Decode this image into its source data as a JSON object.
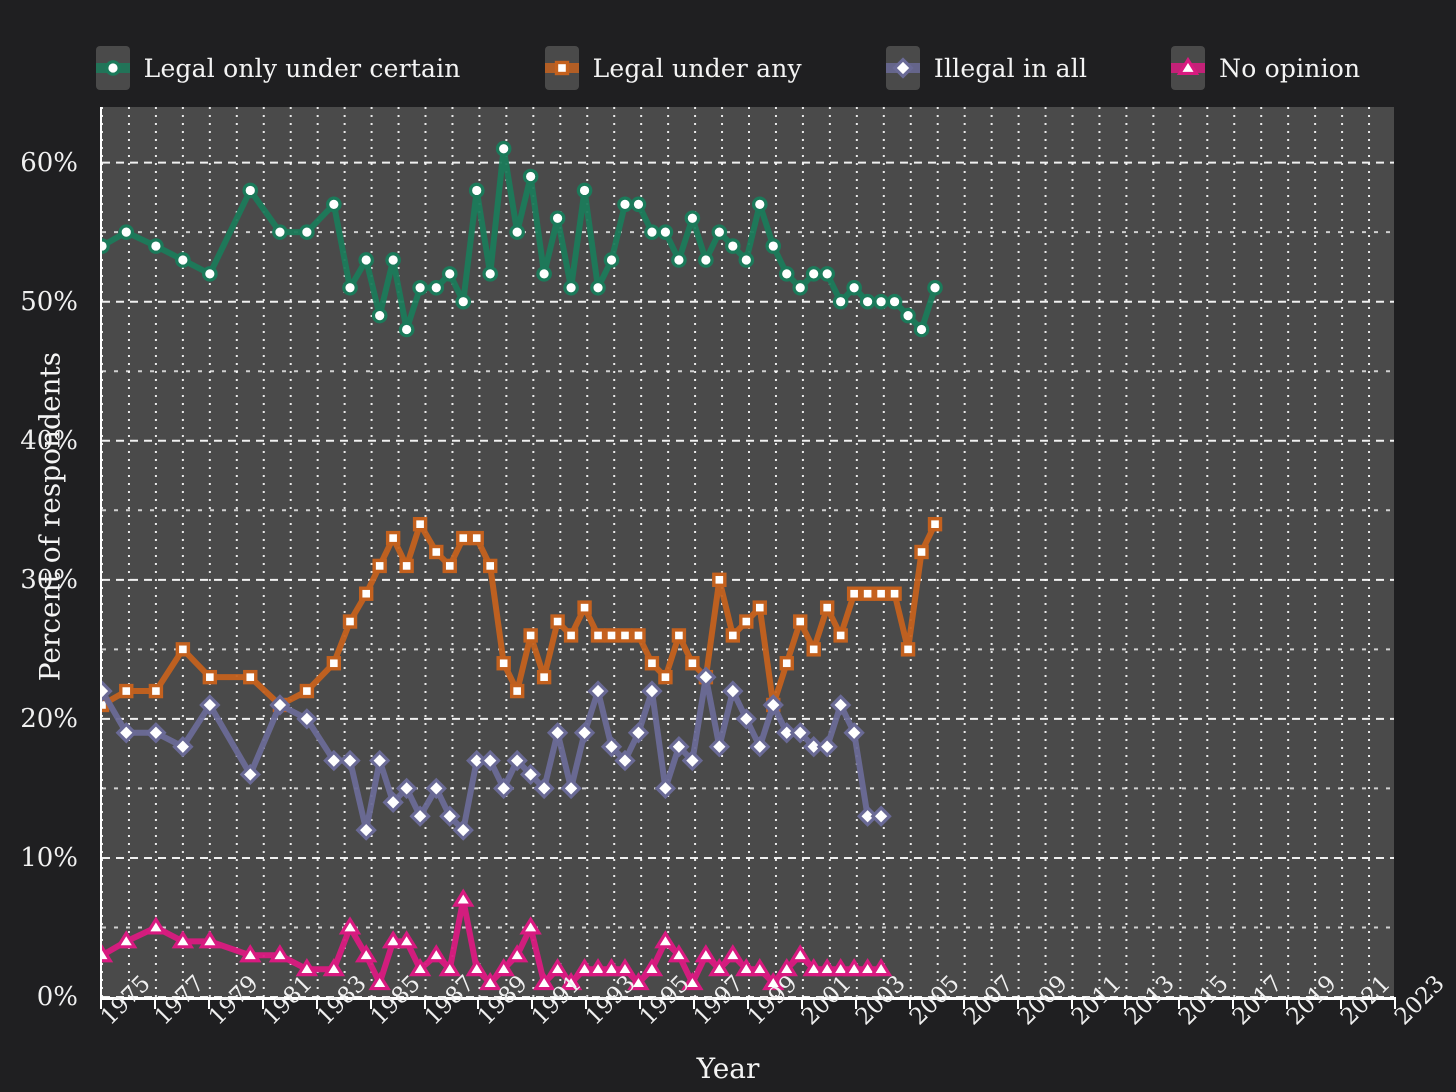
{
  "chart_data": {
    "type": "line",
    "title": "",
    "xlabel": "Year",
    "ylabel": "Percent of respondents",
    "xlim": [
      1975,
      2023
    ],
    "ylim": [
      0,
      64
    ],
    "yticks": [
      0,
      10,
      20,
      30,
      40,
      50,
      60
    ],
    "ytick_labels": [
      "0%",
      "10%",
      "20%",
      "30%",
      "40%",
      "50%",
      "60%"
    ],
    "y_minor_step": 5,
    "xticks": [
      1975,
      1977,
      1979,
      1981,
      1983,
      1985,
      1987,
      1989,
      1991,
      1993,
      1995,
      1997,
      1999,
      2001,
      2003,
      2005,
      2007,
      2009,
      2011,
      2013,
      2015,
      2017,
      2019,
      2021,
      2023
    ],
    "xtick_labels": [
      "1975",
      "1977",
      "1979",
      "1981",
      "1983",
      "1985",
      "1987",
      "1989",
      "1991",
      "1993",
      "1995",
      "1997",
      "1999",
      "2001",
      "2003",
      "2005",
      "2007",
      "2009",
      "2011",
      "2013",
      "2015",
      "2017",
      "2019",
      "2021",
      "2023"
    ],
    "grid": true,
    "grid_style": "dotted-white",
    "legend_position": "top-center",
    "background": "#1f1f21",
    "plot_background": "#4a4a4a",
    "series": [
      {
        "name": "Legal only under certain",
        "color": "#1b7a5a",
        "marker": "circle",
        "points": [
          [
            1975.0,
            54
          ],
          [
            1975.9,
            55
          ],
          [
            1977.0,
            54
          ],
          [
            1978.0,
            53
          ],
          [
            1979.0,
            52
          ],
          [
            1980.5,
            58
          ],
          [
            1981.6,
            55
          ],
          [
            1982.6,
            55
          ],
          [
            1983.6,
            57
          ],
          [
            1984.2,
            51
          ],
          [
            1984.8,
            53
          ],
          [
            1985.3,
            49
          ],
          [
            1985.8,
            53
          ],
          [
            1986.3,
            48
          ],
          [
            1986.8,
            51
          ],
          [
            1987.4,
            51
          ],
          [
            1987.9,
            52
          ],
          [
            1988.4,
            50
          ],
          [
            1988.9,
            58
          ],
          [
            1989.4,
            52
          ],
          [
            1989.9,
            61
          ],
          [
            1990.4,
            55
          ],
          [
            1990.9,
            59
          ],
          [
            1991.4,
            52
          ],
          [
            1991.9,
            56
          ],
          [
            1992.4,
            51
          ],
          [
            1992.9,
            58
          ],
          [
            1993.4,
            51
          ],
          [
            1993.9,
            53
          ],
          [
            1994.4,
            57
          ],
          [
            1994.9,
            57
          ],
          [
            1995.4,
            55
          ],
          [
            1995.9,
            55
          ],
          [
            1996.4,
            53
          ],
          [
            1996.9,
            56
          ],
          [
            1997.4,
            53
          ],
          [
            1997.9,
            55
          ],
          [
            1998.4,
            54
          ],
          [
            1998.9,
            53
          ],
          [
            1999.4,
            57
          ],
          [
            1999.9,
            54
          ],
          [
            2000.4,
            52
          ],
          [
            2000.9,
            51
          ],
          [
            2001.4,
            52
          ],
          [
            2001.9,
            52
          ],
          [
            2002.4,
            50
          ],
          [
            2002.9,
            51
          ],
          [
            2003.4,
            50
          ],
          [
            2003.9,
            50
          ],
          [
            2004.4,
            50
          ],
          [
            2004.9,
            49
          ],
          [
            2005.4,
            48
          ],
          [
            2005.9,
            51
          ]
        ]
      },
      {
        "name": "Legal under any",
        "color": "#c4611e",
        "marker": "square",
        "points": [
          [
            1975.0,
            21
          ],
          [
            1975.9,
            22
          ],
          [
            1977.0,
            22
          ],
          [
            1978.0,
            25
          ],
          [
            1979.0,
            23
          ],
          [
            1980.5,
            23
          ],
          [
            1981.6,
            21
          ],
          [
            1982.6,
            22
          ],
          [
            1983.6,
            24
          ],
          [
            1984.2,
            27
          ],
          [
            1984.8,
            29
          ],
          [
            1985.3,
            31
          ],
          [
            1985.8,
            33
          ],
          [
            1986.3,
            31
          ],
          [
            1986.8,
            34
          ],
          [
            1987.4,
            32
          ],
          [
            1987.9,
            31
          ],
          [
            1988.4,
            33
          ],
          [
            1988.9,
            33
          ],
          [
            1989.4,
            31
          ],
          [
            1989.9,
            24
          ],
          [
            1990.4,
            22
          ],
          [
            1990.9,
            26
          ],
          [
            1991.4,
            23
          ],
          [
            1991.9,
            27
          ],
          [
            1992.4,
            26
          ],
          [
            1992.9,
            28
          ],
          [
            1993.4,
            26
          ],
          [
            1993.9,
            26
          ],
          [
            1994.4,
            26
          ],
          [
            1994.9,
            26
          ],
          [
            1995.4,
            24
          ],
          [
            1995.9,
            23
          ],
          [
            1996.4,
            26
          ],
          [
            1996.9,
            24
          ],
          [
            1997.4,
            23
          ],
          [
            1997.9,
            30
          ],
          [
            1998.4,
            26
          ],
          [
            1998.9,
            27
          ],
          [
            1999.4,
            28
          ],
          [
            1999.9,
            21
          ],
          [
            2000.4,
            24
          ],
          [
            2000.9,
            27
          ],
          [
            2001.4,
            25
          ],
          [
            2001.9,
            28
          ],
          [
            2002.4,
            26
          ],
          [
            2002.9,
            29
          ],
          [
            2003.4,
            29
          ],
          [
            2003.9,
            29
          ],
          [
            2004.4,
            29
          ],
          [
            2004.9,
            25
          ],
          [
            2005.4,
            32
          ],
          [
            2005.9,
            34
          ]
        ]
      },
      {
        "name": "Illegal in all",
        "color": "#6a6a96",
        "marker": "diamond",
        "points": [
          [
            1975.0,
            22
          ],
          [
            1975.9,
            19
          ],
          [
            1977.0,
            19
          ],
          [
            1978.0,
            18
          ],
          [
            1979.0,
            21
          ],
          [
            1980.5,
            16
          ],
          [
            1981.6,
            21
          ],
          [
            1982.6,
            20
          ],
          [
            1983.6,
            17
          ],
          [
            1984.2,
            17
          ],
          [
            1984.8,
            12
          ],
          [
            1985.3,
            17
          ],
          [
            1985.8,
            14
          ],
          [
            1986.3,
            15
          ],
          [
            1986.8,
            13
          ],
          [
            1987.4,
            15
          ],
          [
            1987.9,
            13
          ],
          [
            1988.4,
            12
          ],
          [
            1988.9,
            17
          ],
          [
            1989.4,
            17
          ],
          [
            1989.9,
            15
          ],
          [
            1990.4,
            17
          ],
          [
            1990.9,
            16
          ],
          [
            1991.4,
            15
          ],
          [
            1991.9,
            19
          ],
          [
            1992.4,
            15
          ],
          [
            1992.9,
            19
          ],
          [
            1993.4,
            22
          ],
          [
            1993.9,
            18
          ],
          [
            1994.4,
            17
          ],
          [
            1994.9,
            19
          ],
          [
            1995.4,
            22
          ],
          [
            1995.9,
            15
          ],
          [
            1996.4,
            18
          ],
          [
            1996.9,
            17
          ],
          [
            1997.4,
            23
          ],
          [
            1997.9,
            18
          ],
          [
            1998.4,
            22
          ],
          [
            1998.9,
            20
          ],
          [
            1999.4,
            18
          ],
          [
            1999.9,
            21
          ],
          [
            2000.4,
            19
          ],
          [
            2000.9,
            19
          ],
          [
            2001.4,
            18
          ],
          [
            2001.9,
            18
          ],
          [
            2002.4,
            21
          ],
          [
            2002.9,
            19
          ],
          [
            2003.4,
            13
          ],
          [
            2003.9,
            13
          ]
        ]
      },
      {
        "name": "No opinion",
        "color": "#d91a80",
        "marker": "triangle",
        "points": [
          [
            1975.0,
            3
          ],
          [
            1975.9,
            4
          ],
          [
            1977.0,
            5
          ],
          [
            1978.0,
            4
          ],
          [
            1979.0,
            4
          ],
          [
            1980.5,
            3
          ],
          [
            1981.6,
            3
          ],
          [
            1982.6,
            2
          ],
          [
            1983.6,
            2
          ],
          [
            1984.2,
            5
          ],
          [
            1984.8,
            3
          ],
          [
            1985.3,
            1
          ],
          [
            1985.8,
            4
          ],
          [
            1986.3,
            4
          ],
          [
            1986.8,
            2
          ],
          [
            1987.4,
            3
          ],
          [
            1987.9,
            2
          ],
          [
            1988.4,
            7
          ],
          [
            1988.9,
            2
          ],
          [
            1989.4,
            1
          ],
          [
            1989.9,
            2
          ],
          [
            1990.4,
            3
          ],
          [
            1990.9,
            5
          ],
          [
            1991.4,
            1
          ],
          [
            1991.9,
            2
          ],
          [
            1992.4,
            1
          ],
          [
            1992.9,
            2
          ],
          [
            1993.4,
            2
          ],
          [
            1993.9,
            2
          ],
          [
            1994.4,
            2
          ],
          [
            1994.9,
            1
          ],
          [
            1995.4,
            2
          ],
          [
            1995.9,
            4
          ],
          [
            1996.4,
            3
          ],
          [
            1996.9,
            1
          ],
          [
            1997.4,
            3
          ],
          [
            1997.9,
            2
          ],
          [
            1998.4,
            3
          ],
          [
            1998.9,
            2
          ],
          [
            1999.4,
            2
          ],
          [
            1999.9,
            1
          ],
          [
            2000.4,
            2
          ],
          [
            2000.9,
            3
          ],
          [
            2001.4,
            2
          ],
          [
            2001.9,
            2
          ],
          [
            2002.4,
            2
          ],
          [
            2002.9,
            2
          ],
          [
            2003.4,
            2
          ],
          [
            2003.9,
            2
          ]
        ]
      }
    ]
  },
  "legend": {
    "items": [
      {
        "label": "Legal only under certain",
        "color": "#1b7a5a",
        "marker": "circle"
      },
      {
        "label": "Legal under any",
        "color": "#c4611e",
        "marker": "square"
      },
      {
        "label": "Illegal in all",
        "color": "#6a6a96",
        "marker": "diamond"
      },
      {
        "label": "No opinion",
        "color": "#d91a80",
        "marker": "triangle"
      }
    ]
  },
  "axes": {
    "x_title": "Year",
    "y_title": "Percent of respondents"
  }
}
